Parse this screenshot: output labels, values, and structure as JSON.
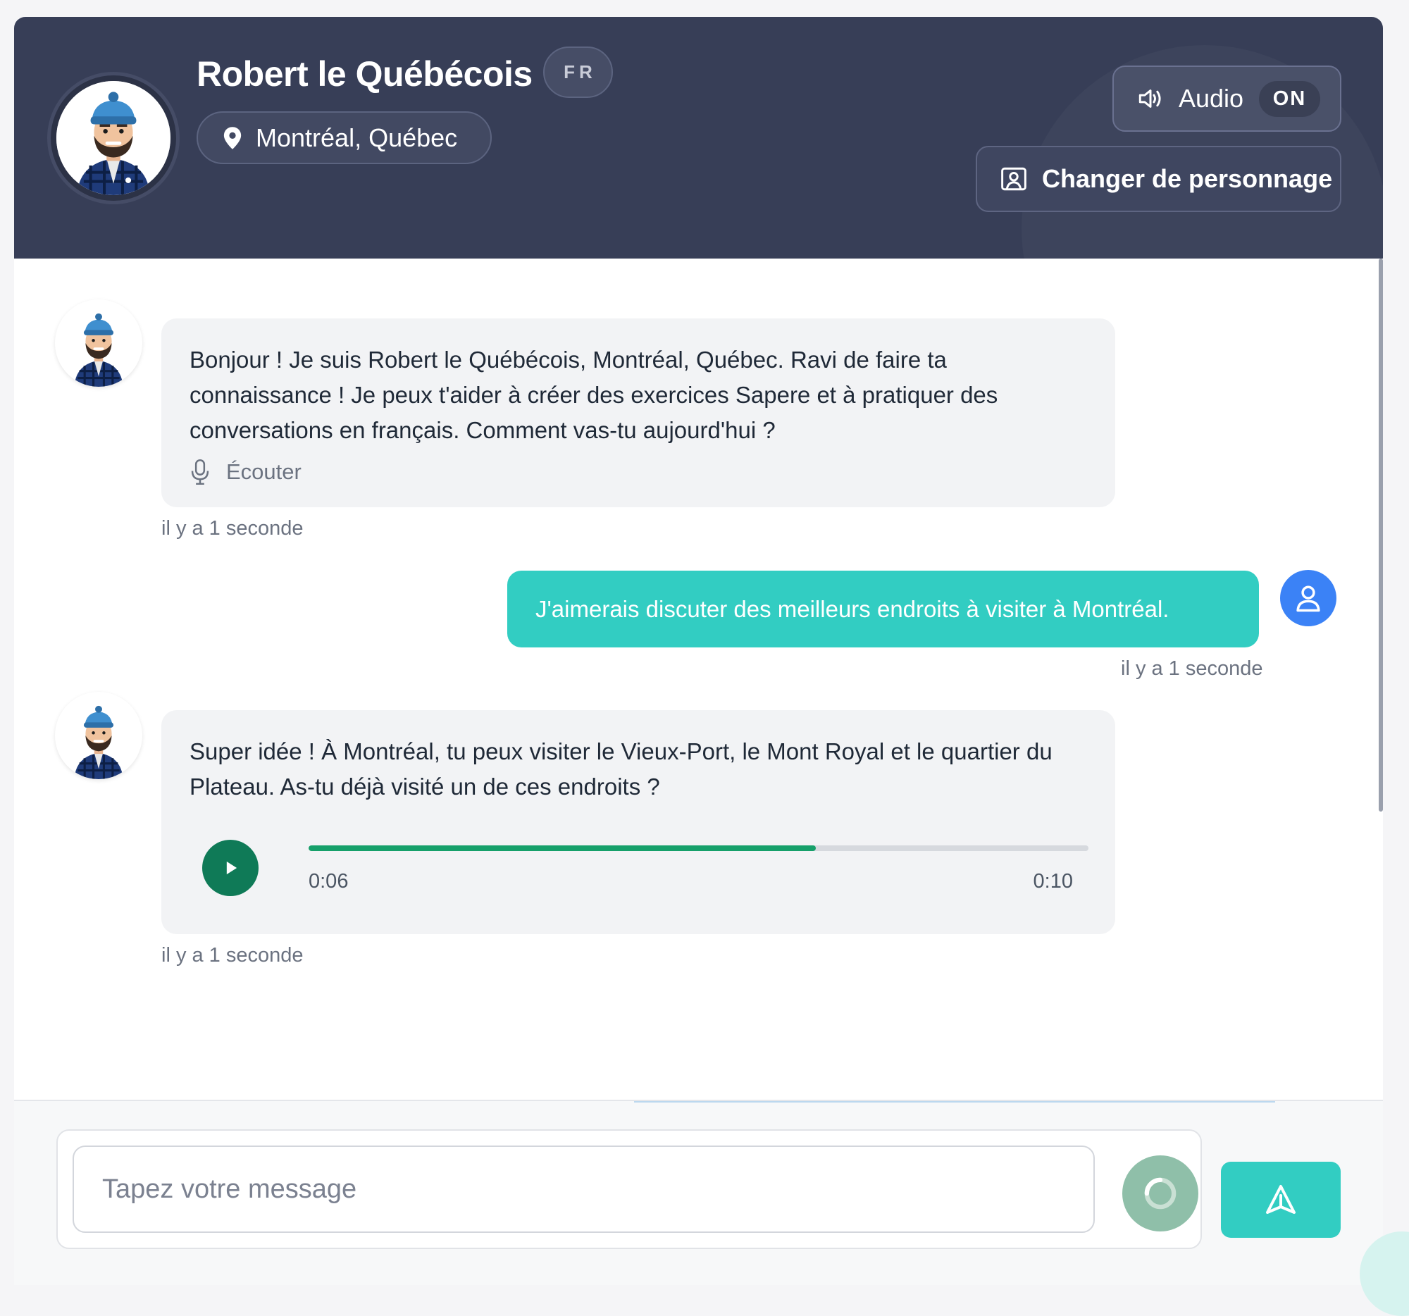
{
  "header": {
    "character_name": "Robert le Québécois",
    "language_badge": "FR",
    "location": "Montréal, Québec",
    "audio_label": "Audio",
    "audio_state": "ON",
    "change_character_label": "Changer de personnage",
    "bg_color": "#373e57"
  },
  "messages": [
    {
      "sender": "bot",
      "text": "Bonjour ! Je suis Robert le Québécois, Montréal, Québec. Ravi de faire ta connaissance ! Je peux t'aider à créer des exercices Sapere et à pratiquer des conversations en français. Comment vas-tu aujourd'hui ?",
      "listen_label": "Écouter",
      "timestamp": "il y a 1 seconde"
    },
    {
      "sender": "user",
      "text": "J'aimerais discuter des meilleurs endroits à visiter à Montréal.",
      "timestamp": "il y a 1 seconde"
    },
    {
      "sender": "bot",
      "text": "Super idée ! À Montréal, tu peux visiter le Vieux-Port, le Mont Royal et le quartier du Plateau. As-tu déjà visité un de ces endroits ?",
      "audio": {
        "current_time": "0:06",
        "total_time": "0:10",
        "progress": 0.65
      },
      "timestamp": "il y a 1 seconde"
    }
  ],
  "composer": {
    "placeholder": "Tapez votre message"
  },
  "colors": {
    "accent_teal": "#32cdc2",
    "user_avatar": "#3b82f6",
    "play_button": "#0f7a57",
    "progress_fill": "#16a06a"
  },
  "icons": {
    "location": "map-pin-icon",
    "audio": "speaker-icon",
    "change": "portrait-icon",
    "listen": "microphone-icon",
    "user": "user-icon",
    "play": "play-icon",
    "mic": "loading-spinner-icon",
    "send": "send-icon"
  }
}
